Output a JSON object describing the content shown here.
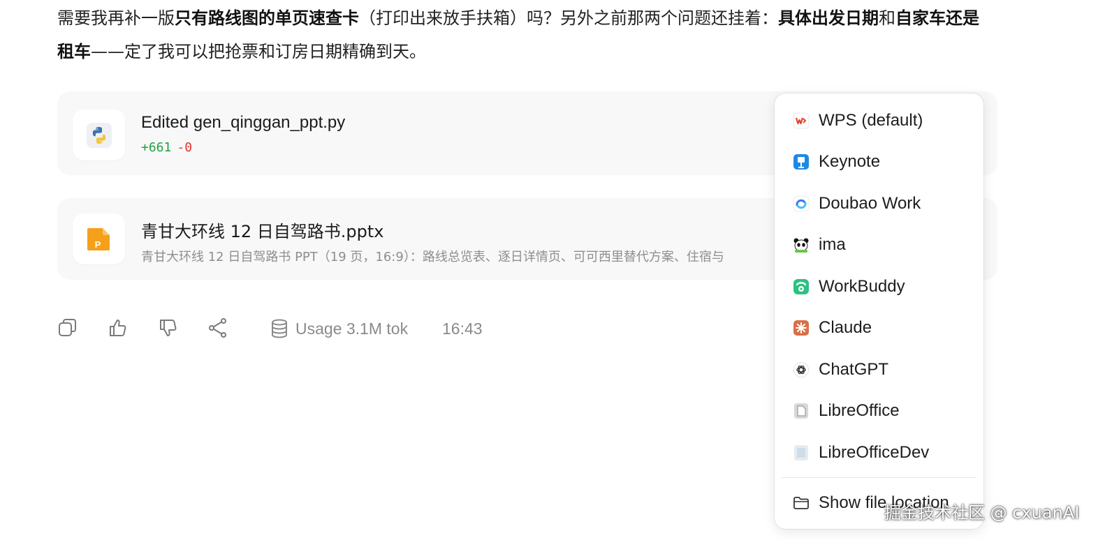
{
  "message": {
    "part1": "需要我再补一版",
    "bold1": "只有路线图的单页速查卡",
    "part2": "（打印出来放手扶箱）吗？另外之前那两个问题还挂着：",
    "bold2": "具体出发日期",
    "part3": "和",
    "bold3": "自家车还是租车",
    "part4": "——定了我可以把抢票和订房日期精确到天。"
  },
  "cards": [
    {
      "title": "Edited gen_qinggan_ppt.py",
      "added": "+661",
      "removed": "-0",
      "icon": "python-file-icon"
    },
    {
      "title": "青甘大环线 12 日自驾路书.pptx",
      "description": "青甘大环线 12 日自驾路书 PPT（19 页，16:9）：路线总览表、逐日详情页、可可西里替代方案、住宿与",
      "icon_letter": "P",
      "icon_color": "#f5a01a"
    }
  ],
  "actions": {
    "usage": "Usage 3.1M tok",
    "time": "16:43"
  },
  "menu": {
    "items": [
      {
        "label": "WPS (default)",
        "icon": "wps-icon"
      },
      {
        "label": "Keynote",
        "icon": "keynote-icon"
      },
      {
        "label": "Doubao Work",
        "icon": "doubao-icon"
      },
      {
        "label": "ima",
        "icon": "panda-icon"
      },
      {
        "label": "WorkBuddy",
        "icon": "workbuddy-icon"
      },
      {
        "label": "Claude",
        "icon": "claude-icon"
      },
      {
        "label": "ChatGPT",
        "icon": "chatgpt-icon"
      },
      {
        "label": "LibreOffice",
        "icon": "libreoffice-icon"
      },
      {
        "label": "LibreOfficeDev",
        "icon": "libreofficedev-icon"
      }
    ],
    "footer": {
      "label": "Show file location",
      "icon": "folder-icon"
    }
  },
  "watermark": "掘金技术社区 @ cxuanAI",
  "colors": {
    "added": "#22a045",
    "removed": "#e0322f",
    "muted": "#8a8a8a",
    "card_bg": "#f8f8f8"
  }
}
